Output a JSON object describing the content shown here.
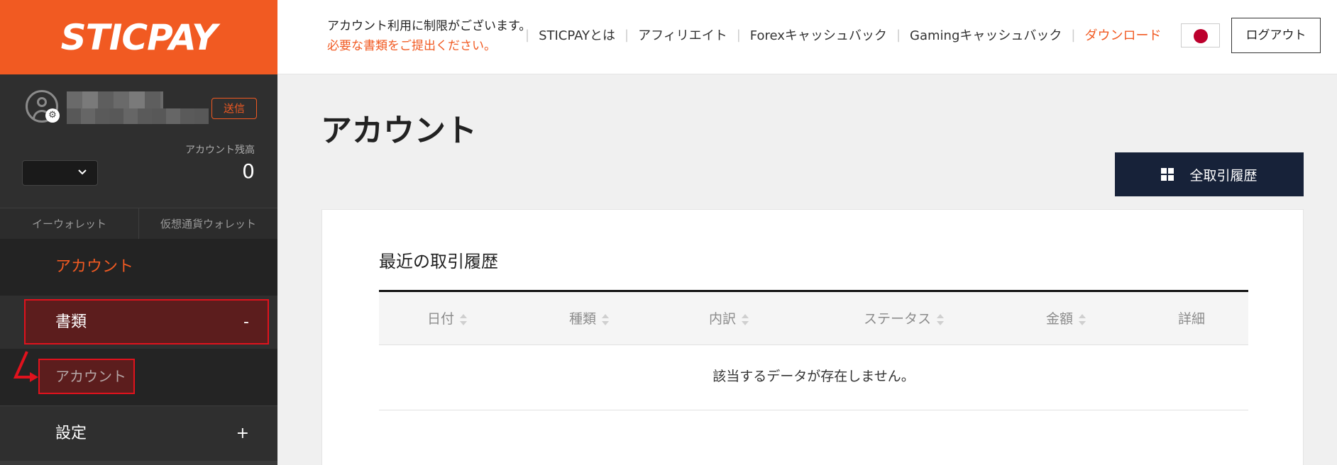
{
  "sidebar": {
    "logo": "STICPAY",
    "profile": {
      "send_label": "送信",
      "balance_label": "アカウント残高",
      "balance_value": "0",
      "currency_value": ""
    },
    "wallet_tabs": [
      "イーウォレット",
      "仮想通貨ウォレット"
    ],
    "nav": {
      "account": "アカウント",
      "documents": {
        "label": "書類",
        "toggle": "-",
        "sub_account": "アカウント"
      },
      "settings": {
        "label": "設定",
        "toggle": "+"
      }
    }
  },
  "header": {
    "notice_line1": "アカウント利用に制限がございます。",
    "notice_line2": "必要な書類をご提出ください。",
    "nav": [
      "STICPAYとは",
      "アフィリエイト",
      "Forexキャッシュバック",
      "Gamingキャッシュバック"
    ],
    "download": "ダウンロード",
    "logout": "ログアウト"
  },
  "main": {
    "title": "アカウント",
    "history_button": "全取引履歴",
    "card": {
      "title": "最近の取引履歴",
      "columns": [
        "日付",
        "種類",
        "内訳",
        "ステータス",
        "金額",
        "詳細"
      ],
      "empty_message": "該当するデータが存在しません。"
    }
  },
  "colors": {
    "brand_orange": "#f15a22",
    "navy": "#172239",
    "highlight_red": "#e0121d"
  }
}
